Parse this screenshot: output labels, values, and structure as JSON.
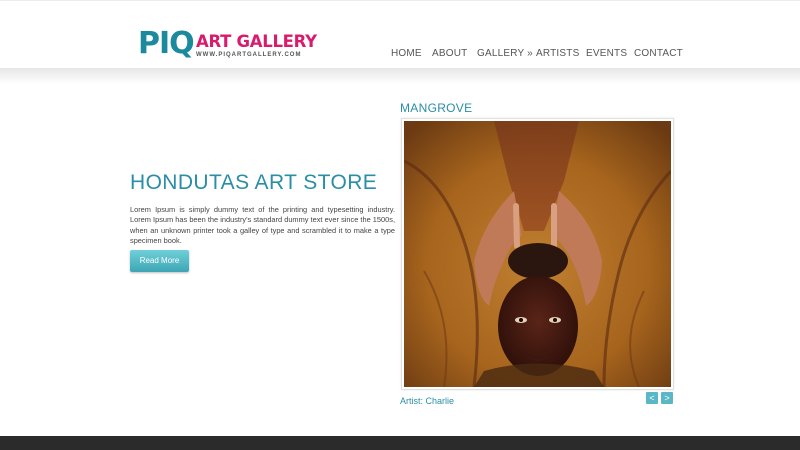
{
  "logo": {
    "piq": "PIQ",
    "art_gallery": "ART GALLERY",
    "url": "WWW.PIQARTGALLERY.COM"
  },
  "nav": {
    "items": [
      {
        "label": "HOME"
      },
      {
        "label": "ABOUT"
      },
      {
        "label": "GALLERY »"
      },
      {
        "label": "ARTISTS"
      },
      {
        "label": "EVENTS"
      },
      {
        "label": "CONTACT"
      }
    ]
  },
  "hero": {
    "title": "HONDUTAS ART STORE",
    "text": "Lorem Ipsum is simply dummy text of the printing and typesetting industry. Lorem Ipsum has been the industry's standard dummy text ever since the 1500s, when an unknown printer took a galley of type and scrambled it to make a type specimen book.",
    "button_label": "Read More"
  },
  "artwork": {
    "title": "MANGROVE",
    "artist": "Artist: Charlie",
    "prev_icon": "chevron-left-icon",
    "next_icon": "chevron-right-icon",
    "prev_glyph": "<",
    "next_glyph": ">"
  },
  "colors": {
    "accent": "#2a8ea6",
    "brand_pink": "#d81b6d",
    "button": "#4fb6c4",
    "footer": "#2b2b2b"
  }
}
